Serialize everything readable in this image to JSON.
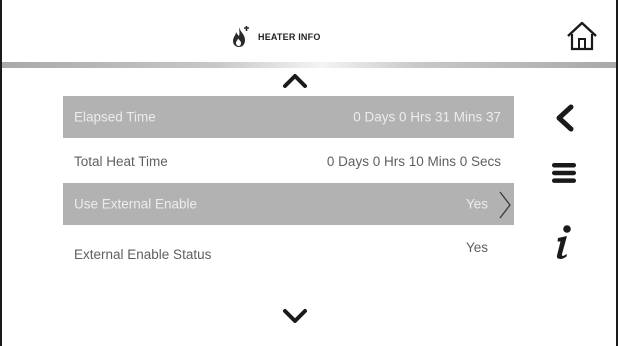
{
  "header": {
    "title": "HEATER INFO",
    "title_icon": "flame-icon",
    "home_icon": "home-icon"
  },
  "navigation": {
    "scroll_up_icon": "chevron-up-icon",
    "scroll_down_icon": "chevron-down-icon",
    "side_buttons": [
      {
        "name": "back-icon"
      },
      {
        "name": "menu-icon"
      },
      {
        "name": "info-icon"
      }
    ]
  },
  "rows": [
    {
      "label": "Elapsed Time",
      "value": "0 Days  0 Hrs  31 Mins  37"
    },
    {
      "label": "Total Heat Time",
      "value": "0 Days  0 Hrs  10 Mins  0 Secs"
    },
    {
      "label": "Use External Enable",
      "value": "Yes"
    },
    {
      "label": "External Enable Status",
      "value": "Yes"
    }
  ],
  "colors": {
    "row_highlight": "#b2b2b2",
    "row_text_highlight": "#ececec",
    "row_text_plain": "#5f5f5f",
    "icon_dark": "#1a1a1a",
    "background": "#ffffff"
  }
}
